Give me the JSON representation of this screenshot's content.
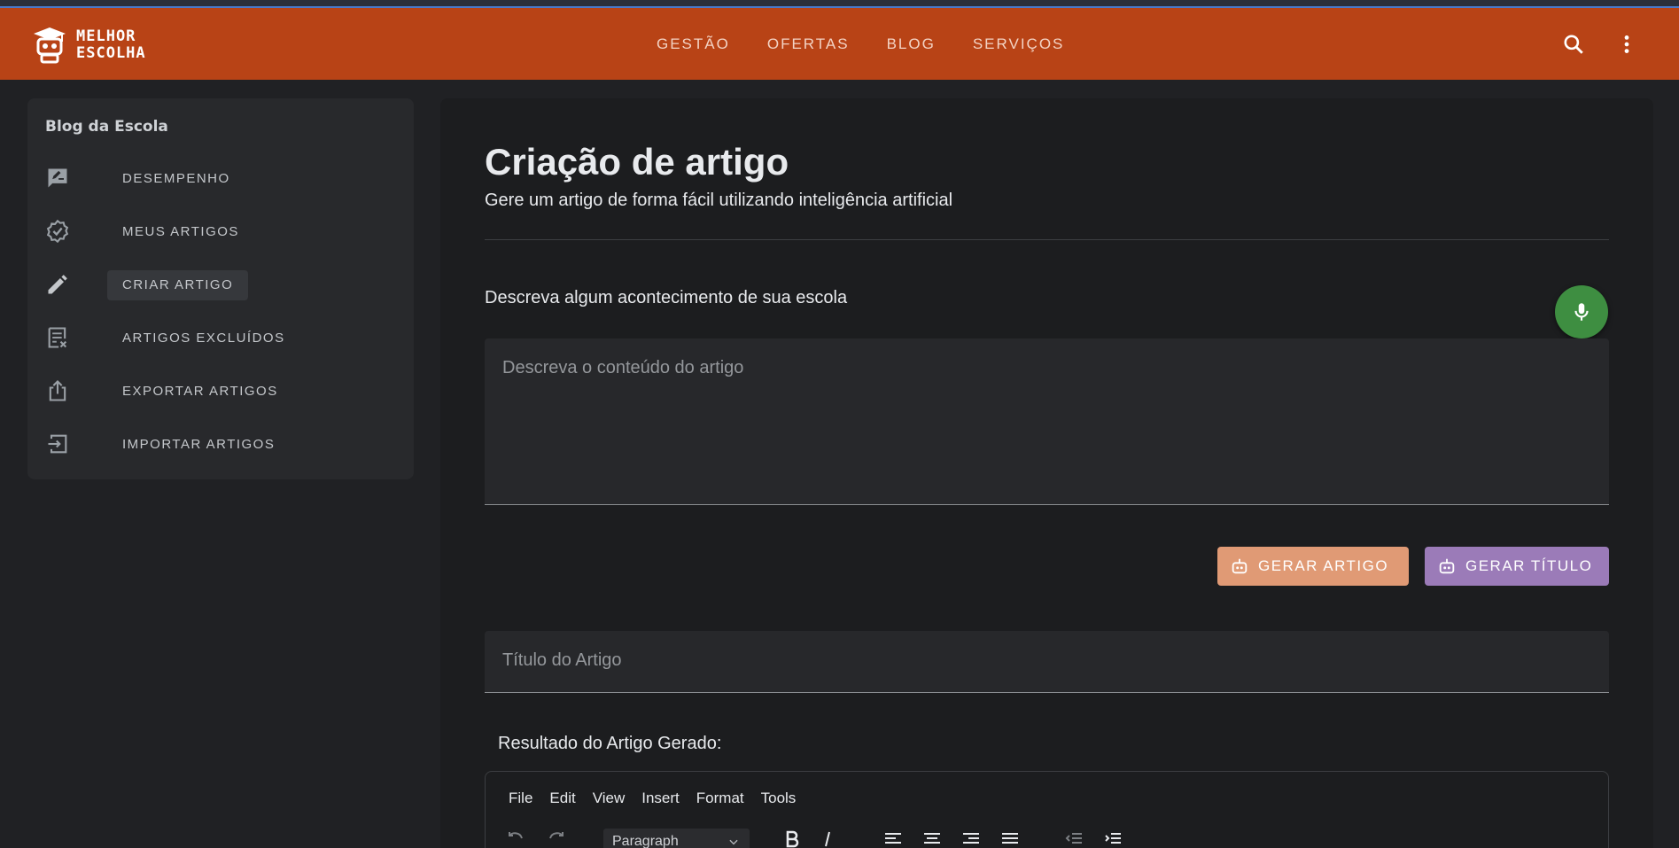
{
  "header": {
    "logo_line1": "MELHOR",
    "logo_line2": "ESCOLHA",
    "nav": [
      "GESTÃO",
      "OFERTAS",
      "BLOG",
      "SERVIÇOS"
    ],
    "icons": [
      "search-icon",
      "more-vert-icon"
    ],
    "brand_color": "#b84316"
  },
  "sidebar": {
    "title": "Blog da Escola",
    "items": [
      {
        "label": "DESEMPENHO",
        "icon": "rate-review-icon"
      },
      {
        "label": "MEUS ARTIGOS",
        "icon": "verified-badge-icon"
      },
      {
        "label": "CRIAR ARTIGO",
        "icon": "pencil-icon",
        "active": true
      },
      {
        "label": "ARTIGOS EXCLUÍDOS",
        "icon": "document-remove-icon"
      },
      {
        "label": "EXPORTAR ARTIGOS",
        "icon": "share-export-icon"
      },
      {
        "label": "IMPORTAR ARTIGOS",
        "icon": "login-import-icon"
      }
    ]
  },
  "main": {
    "title": "Criação de artigo",
    "subtitle": "Gere um artigo de forma fácil utilizando inteligência artificial",
    "describe_label": "Descreva algum acontecimento de sua escola",
    "content_placeholder": "Descreva o conteúdo do artigo",
    "btn_generate_article": "GERAR ARTIGO",
    "btn_generate_title": "GERAR TÍTULO",
    "title_placeholder": "Título do Artigo",
    "result_label": "Resultado do Artigo Gerado:",
    "mic_color": "#3e8e41",
    "btn_article_color": "#e09a75",
    "btn_title_color": "#9b7bb8"
  },
  "editor": {
    "menu": [
      "File",
      "Edit",
      "View",
      "Insert",
      "Format",
      "Tools"
    ],
    "block_format": "Paragraph",
    "toolbar_icons": [
      "undo-icon",
      "redo-icon",
      "bold-icon",
      "italic-icon",
      "align-left-icon",
      "align-center-icon",
      "align-right-icon",
      "align-justify-icon",
      "outdent-icon",
      "indent-icon"
    ]
  }
}
